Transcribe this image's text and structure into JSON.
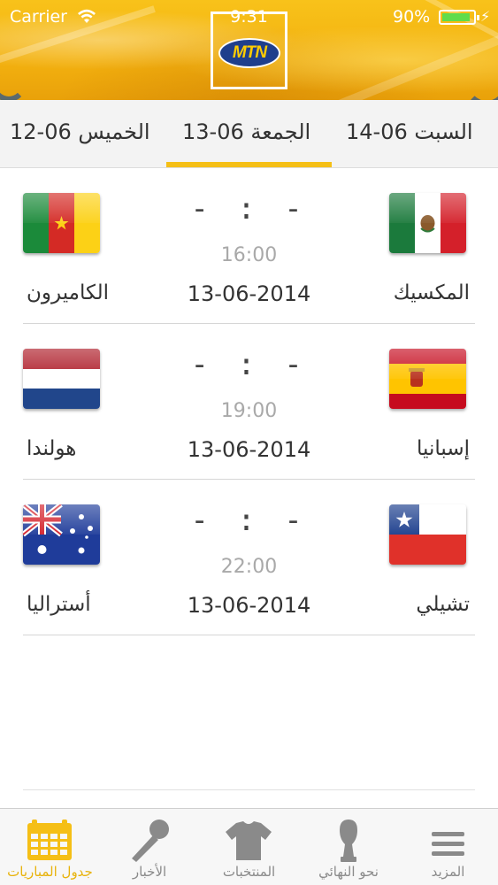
{
  "status_bar": {
    "carrier": "Carrier",
    "time": "9:31",
    "battery": "90%",
    "battery_level": 0.9
  },
  "logo": {
    "text": "MTN"
  },
  "date_tabs": [
    {
      "label": "السبت 06-14",
      "selected": false
    },
    {
      "label": "الجمعة 06-13",
      "selected": true
    },
    {
      "label": "الخميس 06-12",
      "selected": false
    }
  ],
  "matches": [
    {
      "home_team": "المكسيك",
      "away_team": "الكاميرون",
      "home_flag": "mexico-flag",
      "away_flag": "cameroon-flag",
      "score": "- : -",
      "time": "16:00",
      "date": "13-06-2014"
    },
    {
      "home_team": "إسبانيا",
      "away_team": "هولندا",
      "home_flag": "spain-flag",
      "away_flag": "netherlands-flag",
      "score": "- : -",
      "time": "19:00",
      "date": "13-06-2014"
    },
    {
      "home_team": "تشيلي",
      "away_team": "أستراليا",
      "home_flag": "chile-flag",
      "away_flag": "australia-flag",
      "score": "- : -",
      "time": "22:00",
      "date": "13-06-2014"
    }
  ],
  "tabbar": {
    "items": [
      {
        "label": "جدول المباريات",
        "icon": "calendar-icon",
        "active": true
      },
      {
        "label": "الأخبار",
        "icon": "microphone-icon",
        "active": false
      },
      {
        "label": "المنتخبات",
        "icon": "jersey-icon",
        "active": false
      },
      {
        "label": "نحو النهائي",
        "icon": "trophy-icon",
        "active": false
      },
      {
        "label": "المزيد",
        "icon": "menu-icon",
        "active": false
      }
    ]
  },
  "colors": {
    "accent": "#f5bf16",
    "active_tab_text": "#e8b30c",
    "inactive_tab_text": "#8a8a8a",
    "header_yellow": "#f3b10f",
    "battery_green": "#5fdc4b"
  }
}
